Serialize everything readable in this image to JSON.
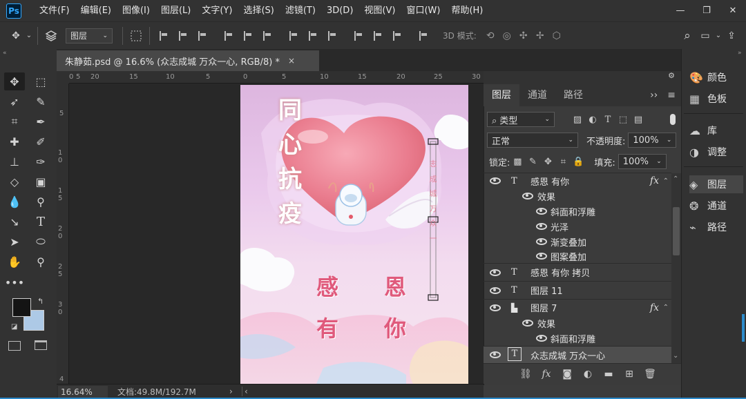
{
  "app": {
    "logo": "Ps"
  },
  "menu": [
    "文件(F)",
    "编辑(E)",
    "图像(I)",
    "图层(L)",
    "文字(Y)",
    "选择(S)",
    "滤镜(T)",
    "3D(D)",
    "视图(V)",
    "窗口(W)",
    "帮助(H)"
  ],
  "window_controls": {
    "minimize": "—",
    "restore": "❐",
    "close": "✕"
  },
  "options_bar": {
    "layer_select": "图层",
    "mode_3d": "3D 模式:"
  },
  "document": {
    "tab_title": "朱静茹.psd @ 16.6% (众志成城 万众一心, RGB/8) *",
    "close": "×"
  },
  "rulers": {
    "top": [
      "0",
      "5",
      "20",
      "15",
      "10",
      "5",
      "0",
      "5",
      "10",
      "15",
      "20",
      "25",
      "30",
      "35",
      "40",
      "45",
      "50"
    ],
    "left": [
      "5",
      "1 0",
      "1 5",
      "2 0",
      "2 5",
      "3 0",
      "4"
    ]
  },
  "poster": {
    "vertical_title": [
      "同",
      "心",
      "抗",
      "疫"
    ],
    "vertical_text": [
      "志",
      "成",
      "城",
      "万",
      "众",
      "一"
    ],
    "blessing_line1": [
      "感",
      "恩"
    ],
    "blessing_line2": [
      "有",
      "你"
    ]
  },
  "status": {
    "zoom": "16.64%",
    "doc_info": "文档:49.8M/192.7M",
    "arrow_right": "›",
    "arrow_left": "‹"
  },
  "layers_panel": {
    "tabs": [
      "图层",
      "通道",
      "路径"
    ],
    "filter_kind": "类型",
    "blend_mode": "正常",
    "opacity_label": "不透明度:",
    "opacity_value": "100%",
    "lock_label": "锁定:",
    "fill_label": "填充:",
    "fill_value": "100%",
    "layers": [
      {
        "name": "感恩 有你",
        "kind": "T",
        "fx": "fx"
      },
      {
        "name": "效果",
        "kind": "effects"
      },
      {
        "name": "斜面和浮雕",
        "kind": "effect"
      },
      {
        "name": "光泽",
        "kind": "effect"
      },
      {
        "name": "渐变叠加",
        "kind": "effect"
      },
      {
        "name": "图案叠加",
        "kind": "effect"
      },
      {
        "name": "感恩 有你 拷贝",
        "kind": "T"
      },
      {
        "name": "图层 11",
        "kind": "T"
      },
      {
        "name": "图层 7",
        "kind": "smart",
        "fx": "fx"
      },
      {
        "name": "效果",
        "kind": "effects"
      },
      {
        "name": "斜面和浮雕",
        "kind": "effect"
      },
      {
        "name": "众志成城 万众一心",
        "kind": "T-selected"
      }
    ],
    "bottom_fx": "fx"
  },
  "right_dock": {
    "items": [
      {
        "label": "颜色",
        "icon": "palette-icon"
      },
      {
        "label": "色板",
        "icon": "swatches-icon"
      },
      {
        "label": "库",
        "icon": "libraries-icon"
      },
      {
        "label": "调整",
        "icon": "adjustments-icon"
      },
      {
        "label": "图层",
        "icon": "layers-icon"
      },
      {
        "label": "通道",
        "icon": "channels-icon"
      },
      {
        "label": "路径",
        "icon": "paths-icon"
      }
    ]
  }
}
